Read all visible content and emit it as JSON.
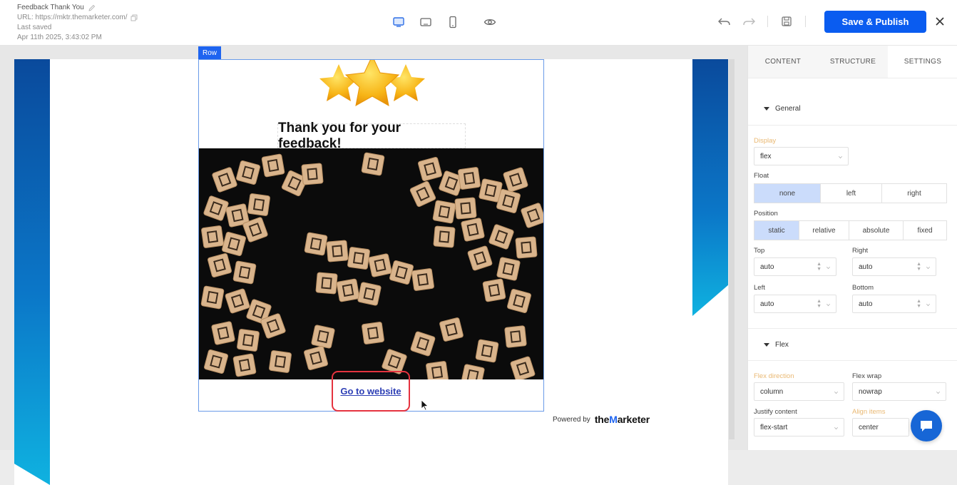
{
  "header": {
    "title": "Feedback Thank You",
    "url": "URL: https://mktr.themarketer.com/",
    "last_saved_label": "Last saved",
    "last_saved_time": "Apr 11th 2025, 3:43:02 PM",
    "publish_label": "Save & Publish"
  },
  "canvas": {
    "row_tag": "Row",
    "heading": "Thank you for your feedback!",
    "link_text": "Go to website",
    "powered_label": "Powered by",
    "brand_pre": "the",
    "brand_m": "M",
    "brand_post": "arketer"
  },
  "panel": {
    "tabs": [
      "CONTENT",
      "STRUCTURE",
      "SETTINGS"
    ],
    "general": {
      "title": "General",
      "display_label": "Display",
      "display_value": "flex",
      "float_label": "Float",
      "float_options": [
        "none",
        "left",
        "right"
      ],
      "position_label": "Position",
      "position_options": [
        "static",
        "relative",
        "absolute",
        "fixed"
      ],
      "top_label": "Top",
      "top_value": "auto",
      "right_label": "Right",
      "right_value": "auto",
      "left_label": "Left",
      "left_value": "auto",
      "bottom_label": "Bottom",
      "bottom_value": "auto"
    },
    "flex": {
      "title": "Flex",
      "direction_label": "Flex direction",
      "direction_value": "column",
      "wrap_label": "Flex wrap",
      "wrap_value": "nowrap",
      "justify_label": "Justify content",
      "justify_value": "flex-start",
      "align_label": "Align items",
      "align_value": "center"
    }
  },
  "colors": {
    "accent": "#0a5cf0",
    "highlight_label": "#e9b872",
    "link": "#2d3fb5",
    "selection_outline": "#e5333f"
  }
}
